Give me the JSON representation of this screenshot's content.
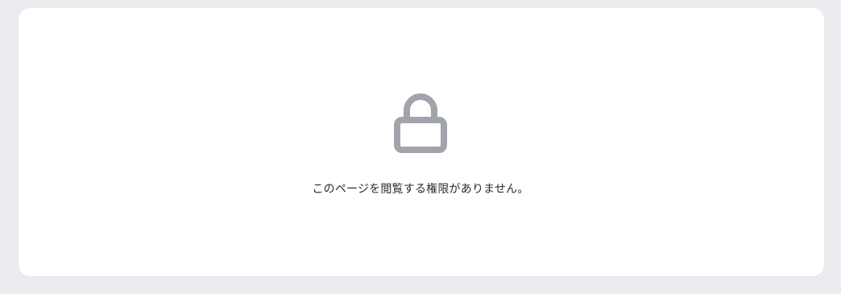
{
  "permission_notice": {
    "icon": "lock-icon",
    "message": "このページを閲覧する権限がありません。",
    "icon_color": "#a1a4aa",
    "card_color": "#ffffff",
    "background_color": "#ebecf0"
  }
}
